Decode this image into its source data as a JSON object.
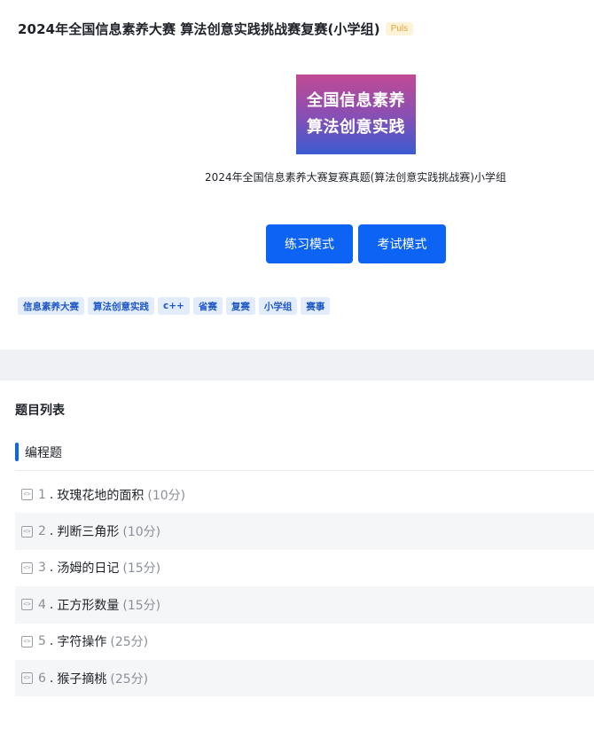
{
  "header": {
    "title": "2024年全国信息素养大赛 算法创意实践挑战赛复赛(小学组)",
    "badge": "Puls"
  },
  "cover": {
    "line1": "全国信息素养",
    "line2": "算法创意实践"
  },
  "description": "2024年全国信息素养大赛复赛真题(算法创意实践挑战赛)小学组",
  "buttons": {
    "practice": "练习模式",
    "exam": "考试模式"
  },
  "tags": [
    "信息素养大赛",
    "算法创意实践",
    "c++",
    "省赛",
    "复赛",
    "小学组",
    "赛事"
  ],
  "list": {
    "heading": "题目列表",
    "section": "编程题",
    "problems": [
      {
        "num": "1",
        "name": "玫瑰花地的面积",
        "score": "(10分)"
      },
      {
        "num": "2",
        "name": "判断三角形",
        "score": "(10分)"
      },
      {
        "num": "3",
        "name": "汤姆的日记",
        "score": "(15分)"
      },
      {
        "num": "4",
        "name": "正方形数量",
        "score": "(15分)"
      },
      {
        "num": "5",
        "name": "字符操作",
        "score": "(25分)"
      },
      {
        "num": "6",
        "name": "猴子摘桃",
        "score": "(25分)"
      }
    ]
  },
  "colors": {
    "accent": "#0d63f3",
    "tag_bg": "#e3ecfb",
    "badge_text": "#e6a23c"
  }
}
